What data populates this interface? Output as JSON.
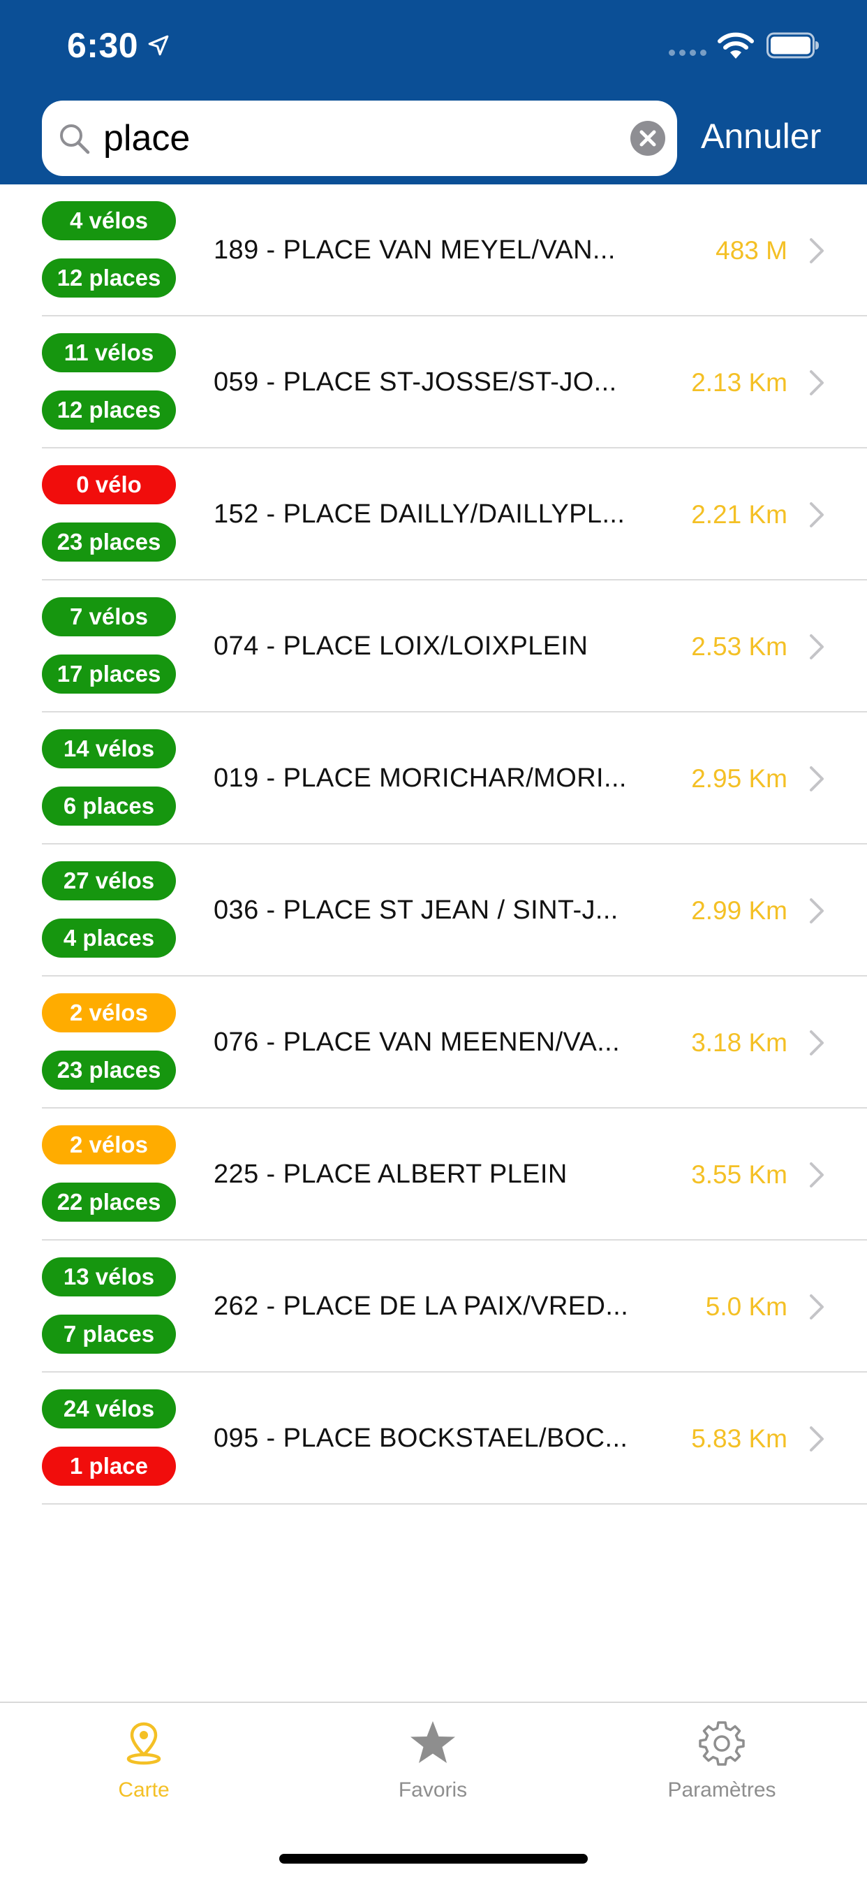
{
  "status_bar": {
    "time": "6:30"
  },
  "search": {
    "value": "place",
    "placeholder": "",
    "cancel_label": "Annuler"
  },
  "colors": {
    "header_blue": "#0B4F96",
    "green": "#16960F",
    "red": "#F10D0C",
    "orange": "#FFAC00",
    "distance_yellow": "#F4C025",
    "tab_inactive": "#8E8E8E"
  },
  "stations": [
    {
      "bikes": "4 vélos",
      "bikes_color": "#16960F",
      "places": "12 places",
      "places_color": "#16960F",
      "name": "189 - PLACE VAN MEYEL/VAN...",
      "distance": "483 M"
    },
    {
      "bikes": "11 vélos",
      "bikes_color": "#16960F",
      "places": "12 places",
      "places_color": "#16960F",
      "name": "059 - PLACE ST-JOSSE/ST-JO...",
      "distance": "2.13 Km"
    },
    {
      "bikes": "0 vélo",
      "bikes_color": "#F10D0C",
      "places": "23 places",
      "places_color": "#16960F",
      "name": "152 - PLACE DAILLY/DAILLYPL...",
      "distance": "2.21 Km"
    },
    {
      "bikes": "7 vélos",
      "bikes_color": "#16960F",
      "places": "17 places",
      "places_color": "#16960F",
      "name": "074 - PLACE LOIX/LOIXPLEIN",
      "distance": "2.53 Km"
    },
    {
      "bikes": "14 vélos",
      "bikes_color": "#16960F",
      "places": "6 places",
      "places_color": "#16960F",
      "name": "019 - PLACE MORICHAR/MORI...",
      "distance": "2.95 Km"
    },
    {
      "bikes": "27 vélos",
      "bikes_color": "#16960F",
      "places": "4 places",
      "places_color": "#16960F",
      "name": "036 - PLACE ST JEAN / SINT-J...",
      "distance": "2.99 Km"
    },
    {
      "bikes": "2 vélos",
      "bikes_color": "#FFAC00",
      "places": "23 places",
      "places_color": "#16960F",
      "name": "076 - PLACE VAN MEENEN/VA...",
      "distance": "3.18 Km"
    },
    {
      "bikes": "2 vélos",
      "bikes_color": "#FFAC00",
      "places": "22 places",
      "places_color": "#16960F",
      "name": "225 - PLACE ALBERT PLEIN",
      "distance": "3.55 Km"
    },
    {
      "bikes": "13 vélos",
      "bikes_color": "#16960F",
      "places": "7 places",
      "places_color": "#16960F",
      "name": "262 - PLACE DE LA PAIX/VRED...",
      "distance": "5.0 Km"
    },
    {
      "bikes": "24 vélos",
      "bikes_color": "#16960F",
      "places": "1 place",
      "places_color": "#F10D0C",
      "name": "095 - PLACE BOCKSTAEL/BOC...",
      "distance": "5.83 Km"
    }
  ],
  "tabs": [
    {
      "label": "Carte",
      "icon": "map-pin-icon",
      "selected": true
    },
    {
      "label": "Favoris",
      "icon": "star-icon",
      "selected": false
    },
    {
      "label": "Paramètres",
      "icon": "gear-icon",
      "selected": false
    }
  ]
}
